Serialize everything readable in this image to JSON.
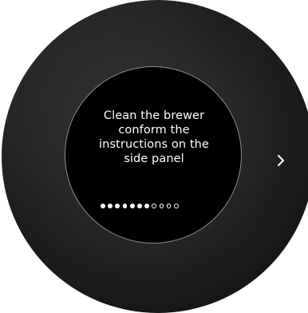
{
  "screen": {
    "message_lines": [
      "Clean the brewer",
      "conform the",
      "instructions on the",
      "side panel"
    ]
  },
  "pagination": {
    "current_step": 7,
    "total_steps": 11
  },
  "navigation": {
    "next_icon": "chevron-right-icon"
  },
  "colors": {
    "screen_background": "#000000",
    "text": "#ffffff",
    "dial": "#2b2b2b"
  }
}
